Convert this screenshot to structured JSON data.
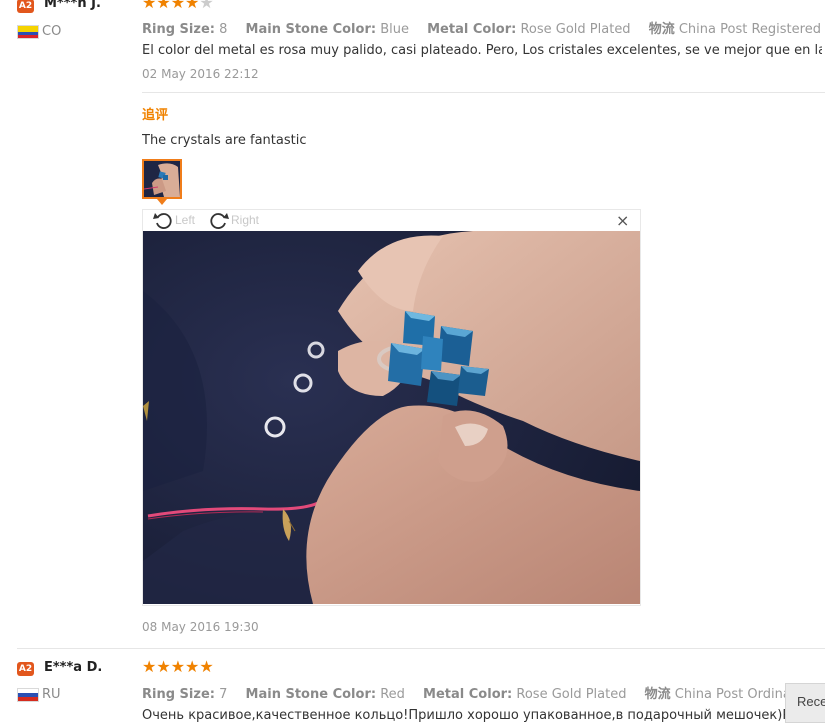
{
  "colors": {
    "badge": "#e2571d",
    "star": "#f08200",
    "star_empty": "#cccccc",
    "accent": "#f07d1a"
  },
  "reviews": [
    {
      "level": "A2",
      "user": "M***n J.",
      "country": "CO",
      "flag_icon": "colombia-flag-icon",
      "rating": 4,
      "attrs": [
        {
          "label": "Ring Size:",
          "value": "8"
        },
        {
          "label": "Main Stone Color:",
          "value": "Blue"
        },
        {
          "label": "Metal Color:",
          "value": "Rose Gold Plated"
        },
        {
          "label": "物流",
          "value": "China Post Registered Air Mail"
        }
      ],
      "text": "El color del metal es rosa muy palido, casi plateado. Pero, Los cristales excelentes, se ve mejor que en la foto.",
      "date": "02 May 2016 22:12",
      "additional": {
        "heading": "追评",
        "text": "The crystals are fantastic",
        "date": "08 May 2016 19:30"
      }
    },
    {
      "level": "A2",
      "user": "E***a D.",
      "country": "RU",
      "flag_icon": "russia-flag-icon",
      "rating": 5,
      "attrs": [
        {
          "label": "Ring Size:",
          "value": "7"
        },
        {
          "label": "Main Stone Color:",
          "value": "Red"
        },
        {
          "label": "Metal Color:",
          "value": "Rose Gold Plated"
        },
        {
          "label": "物流",
          "value": "China Post Ordinary Small Packet Plus"
        }
      ],
      "text": "Очень красивое,качественное кольцо!Пришло хорошо упакованное,в подарочный мешочек)Рекомендую!"
    }
  ],
  "viewer": {
    "rotate_left": "Left",
    "rotate_right": "Right",
    "close": "×"
  },
  "recent_tab": "Recently Viewed"
}
